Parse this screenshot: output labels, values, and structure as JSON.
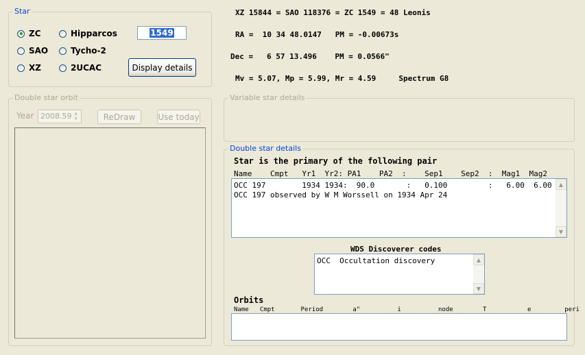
{
  "star_group": {
    "legend": "Star",
    "catalogs": [
      {
        "label": "ZC",
        "selected": true
      },
      {
        "label": "SAO",
        "selected": false
      },
      {
        "label": "XZ",
        "selected": false
      },
      {
        "label": "Hipparcos",
        "selected": false
      },
      {
        "label": "Tycho-2",
        "selected": false
      },
      {
        "label": "2UCAC",
        "selected": false
      }
    ],
    "star_number": "1549",
    "display_button": "Display details"
  },
  "star_info": {
    "ids": "XZ 15844 = SAO 118376 = ZC 1549 = 48 Leonis",
    "ra": "RA =  10 34 48.0147   PM = -0.00673s",
    "dec": "Dec =   6 57 13.496    PM = 0.0566\"",
    "mags": "Mv = 5.07, Mp = 5.99, Mr = 4.59     Spectrum G8"
  },
  "orbit_group": {
    "legend": "Double star orbit",
    "year_label": "Year",
    "year_value": "2008.59",
    "redraw_button": "ReDraw",
    "use_today_button": "Use today"
  },
  "variable_group": {
    "legend": "Variable star details"
  },
  "double_group": {
    "legend": "Double star details",
    "heading": "Star is the primary of the following pair",
    "columns": "Name    Cmpt   Yr1  Yr2: PA1    PA2  :    Sep1    Sep2  :  Mag1  Mag2",
    "rows": [
      "OCC 197        1934 1934:  90.0       :   0.100         :   6.00  6.00",
      "OCC 197 observed by W M Worssell on 1934 Apr 24"
    ],
    "wds_title": "WDS Discoverer codes",
    "wds_rows": [
      "OCC  Occultation discovery"
    ],
    "orbits_title": "Orbits",
    "orbits_columns": "Name   Cmpt       Period        a\"          i          node        T           e         peri"
  }
}
